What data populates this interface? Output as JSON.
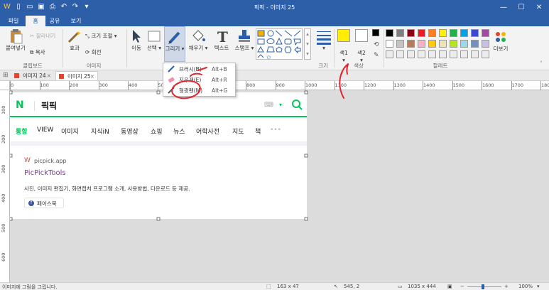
{
  "window": {
    "title": "픽픽 - 이미지 25"
  },
  "menu_tabs": [
    "파일",
    "홈",
    "공유",
    "보기"
  ],
  "ribbon": {
    "paste": "붙여넣기",
    "cut": "잘라내기",
    "copy": "복사",
    "effect": "효과",
    "resize": "크기 조절",
    "rotate": "회전",
    "move": "이동",
    "select": "선택",
    "draw": "그리기",
    "fill": "채우기",
    "text": "텍스트",
    "stamp": "스탬프",
    "size": "크기",
    "color1": "색1",
    "color2": "색2",
    "more_colors": "더보기",
    "groups": {
      "clipboard": "클립보드",
      "image": "이미지",
      "size": "크기",
      "color": "색상",
      "palette": "팔레트"
    }
  },
  "draw_menu": [
    {
      "label": "브러시(B)",
      "shortcut": "Alt+B",
      "icon": "brush-icon"
    },
    {
      "label": "지우개(E)",
      "shortcut": "Alt+R",
      "icon": "eraser-icon"
    },
    {
      "label": "형광펜(M)",
      "shortcut": "Alt+G",
      "icon": "highlighter-icon"
    }
  ],
  "doc_tabs": [
    "이미지 24",
    "이미지 25"
  ],
  "ruler_h": [
    "0",
    "100",
    "200",
    "300",
    "400",
    "500",
    "600",
    "700",
    "800",
    "900",
    "1000",
    "1100",
    "1200",
    "1300",
    "1400",
    "1500",
    "1600",
    "1700",
    "1800"
  ],
  "ruler_v": [
    "100",
    "200",
    "300",
    "400",
    "500",
    "600"
  ],
  "captured": {
    "logo": "N",
    "query": "픽픽",
    "nav_tabs": [
      "통합",
      "VIEW",
      "이미지",
      "지식iN",
      "동영상",
      "쇼핑",
      "뉴스",
      "어학사전",
      "지도",
      "책",
      "•••"
    ],
    "result": {
      "site": "picpick.app",
      "title": "PicPickTools",
      "desc": "사진, 이미지 편집기, 화면캡처 프로그램 소개, 사용방법, 다운로드 등 제공.",
      "chip": "페이스북"
    }
  },
  "status": {
    "message": "이미지에 그림을 그립니다.",
    "selection": "163 x 47",
    "cursor": "545, 2",
    "image_size": "1035 x 444",
    "zoom": "100%"
  },
  "colors": {
    "accent": "#2d5fa8",
    "naver_green": "#03c75a",
    "annotation_red": "#e0252f",
    "color1": "#ffee00",
    "color2": "#ffffff",
    "palette_row1": [
      "#000000",
      "#7f7f7f",
      "#880015",
      "#ed1c24",
      "#ff7f27",
      "#fff200",
      "#22b14c",
      "#00a2e8",
      "#3f48cc",
      "#a349a4"
    ],
    "palette_row2": [
      "#ffffff",
      "#c3c3c3",
      "#b97a57",
      "#ffaec9",
      "#ffc90e",
      "#efe4b0",
      "#b5e61d",
      "#99d9ea",
      "#7092be",
      "#c8bfe7"
    ]
  }
}
